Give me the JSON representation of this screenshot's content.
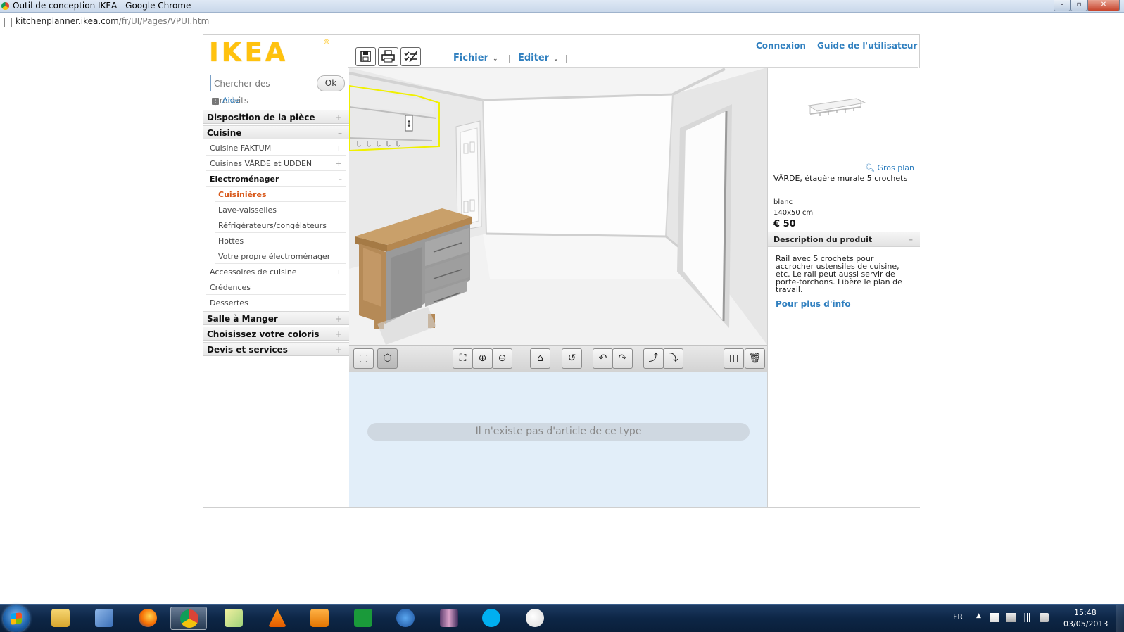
{
  "window": {
    "title": "Outil de conception IKEA - Google Chrome",
    "minimize": "–",
    "maximize": "▫",
    "close": "✕"
  },
  "address": {
    "host": "kitchenplanner.ikea.com",
    "path": "/fr/UI/Pages/VPUI.htm"
  },
  "header": {
    "logo": "IKEA",
    "logo_reg": "®",
    "menus": [
      "Fichier",
      "Editer"
    ],
    "links": [
      "Connexion",
      "Guide de l'utilisateur"
    ]
  },
  "search": {
    "placeholder": "Chercher des produits",
    "ok": "Ok",
    "help": "Aide"
  },
  "nav": {
    "disposition": "Disposition de la pièce",
    "cuisine": "Cuisine",
    "faktum": "Cuisine FAKTUM",
    "varde": "Cuisines VÄRDE et UDDEN",
    "electro": "Electroménager",
    "cuisinieres": "Cuisinières",
    "lave": "Lave-vaisselles",
    "refrig": "Réfrigérateurs/congélateurs",
    "hottes": "Hottes",
    "propre": "Votre propre électroménager",
    "accessoires": "Accessoires de cuisine",
    "credences": "Crédences",
    "dessertes": "Dessertes",
    "salle": "Salle à Manger",
    "coloris": "Choisissez votre coloris",
    "devis": "Devis et services",
    "plus": "+",
    "minus": "–"
  },
  "list": {
    "empty_message": "Il n'existe pas d'article de ce type"
  },
  "product": {
    "zoom_label": "Gros plan",
    "name": "VÄRDE, étagère murale 5 crochets",
    "color": "blanc",
    "size": "140x50 cm",
    "price": "€ 50",
    "desc_header": "Description du produit",
    "description": "Rail avec 5 crochets pour accrocher ustensiles de cuisine, etc. Le rail peut aussi servir de porte-torchons. Libère le plan de travail.",
    "more_link": "Pour plus d'info"
  },
  "taskbar": {
    "lang": "FR",
    "time": "15:48",
    "date": "03/05/2013"
  },
  "colors": {
    "ikea_yellow": "#ffc20e",
    "link_blue": "#2f7fbf",
    "active_orange": "#d8581a",
    "selection_yellow": "#f0f000"
  },
  "icons": {
    "save": "save-icon",
    "print": "print-icon",
    "checklist": "checklist-icon",
    "view2d": "view-2d-icon",
    "view3d": "view-3d-icon",
    "zoom_fit": "zoom-fit-icon",
    "zoom_in": "zoom-in-icon",
    "zoom_out": "zoom-out-icon",
    "home": "home-icon",
    "reset": "reset-icon",
    "rotate_left": "rotate-left-icon",
    "rotate_right": "rotate-right-icon",
    "tilt_up": "tilt-up-icon",
    "tilt_down": "tilt-down-icon",
    "walls": "walls-icon",
    "trash": "trash-icon"
  }
}
